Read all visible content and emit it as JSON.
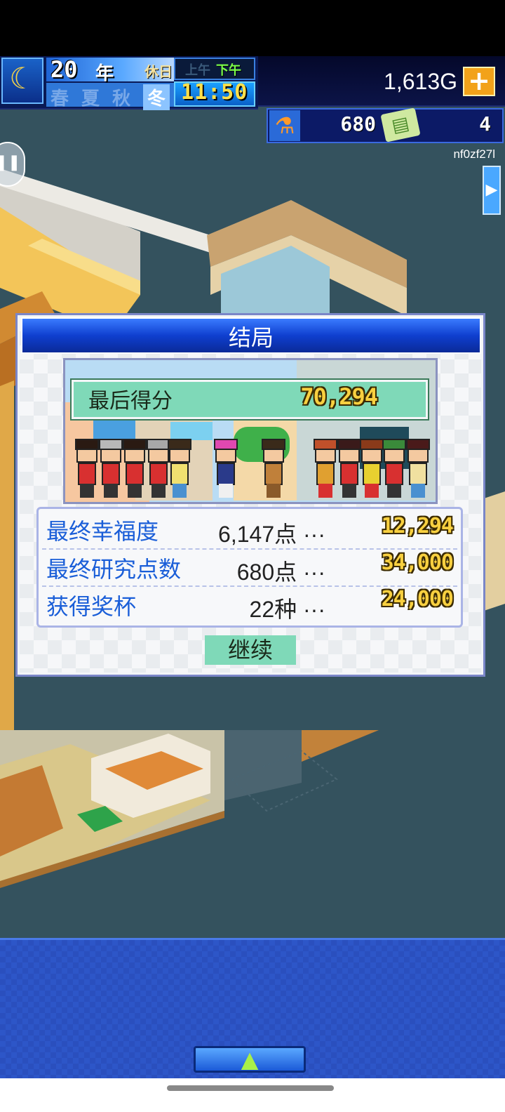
{
  "hud": {
    "year_number": "20",
    "year_unit": "年",
    "day_type": "休日",
    "am_label": "上午",
    "pm_label": "下午",
    "seasons": [
      "春",
      "夏",
      "秋",
      "冬"
    ],
    "active_season": "冬",
    "time": "11:50",
    "money": "1,613G",
    "research_points": "680",
    "tickets": "4",
    "user_id": "nf0zf27l"
  },
  "dialog": {
    "title": "结局",
    "final_score_label": "最后得分",
    "final_score_value": "70,294",
    "rows": [
      {
        "label": "最终幸福度",
        "value": "6,147点 ···",
        "points": "12,294"
      },
      {
        "label": "最终研究点数",
        "value": "680点 ···",
        "points": "34,000"
      },
      {
        "label": "获得奖杯",
        "value": "22种 ···",
        "points": "24,000"
      }
    ],
    "continue_label": "继续"
  },
  "icons": {
    "moon": "moon-icon",
    "plus": "plus-icon",
    "flask": "flask-icon",
    "ticket": "ticket-icon",
    "side_arrow": "arrow-right-icon",
    "pause": "pause-icon",
    "menu": "arrow-up-icon"
  },
  "colors": {
    "title_bar": "#0f3fcf",
    "score_highlight": "#7fd9b8",
    "gold_text": "#f8d040",
    "label_blue": "#1a5ed8"
  }
}
